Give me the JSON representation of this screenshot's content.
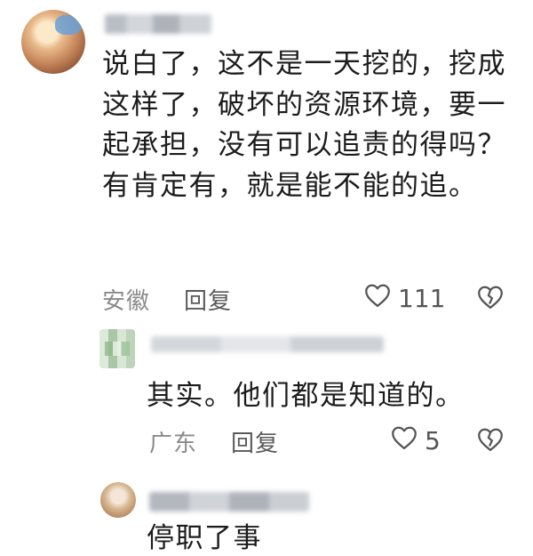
{
  "comments": [
    {
      "text": "说白了，这不是一天挖的，挖成这样了，破坏的资源环境，要一起承担，没有可以追责的得吗？有肯定有，就是能不能的追。",
      "location": "安徽",
      "reply_label": "回复",
      "like_count": "111"
    },
    {
      "text": "其实。他们都是知道的。",
      "location": "广东",
      "reply_label": "回复",
      "like_count": "5"
    },
    {
      "text": "停职了事"
    }
  ],
  "colors": {
    "text": "#1c1c1c",
    "meta": "#8a8a8a",
    "icon": "#555555"
  },
  "icons": [
    "heart-icon",
    "broken-heart-icon"
  ]
}
